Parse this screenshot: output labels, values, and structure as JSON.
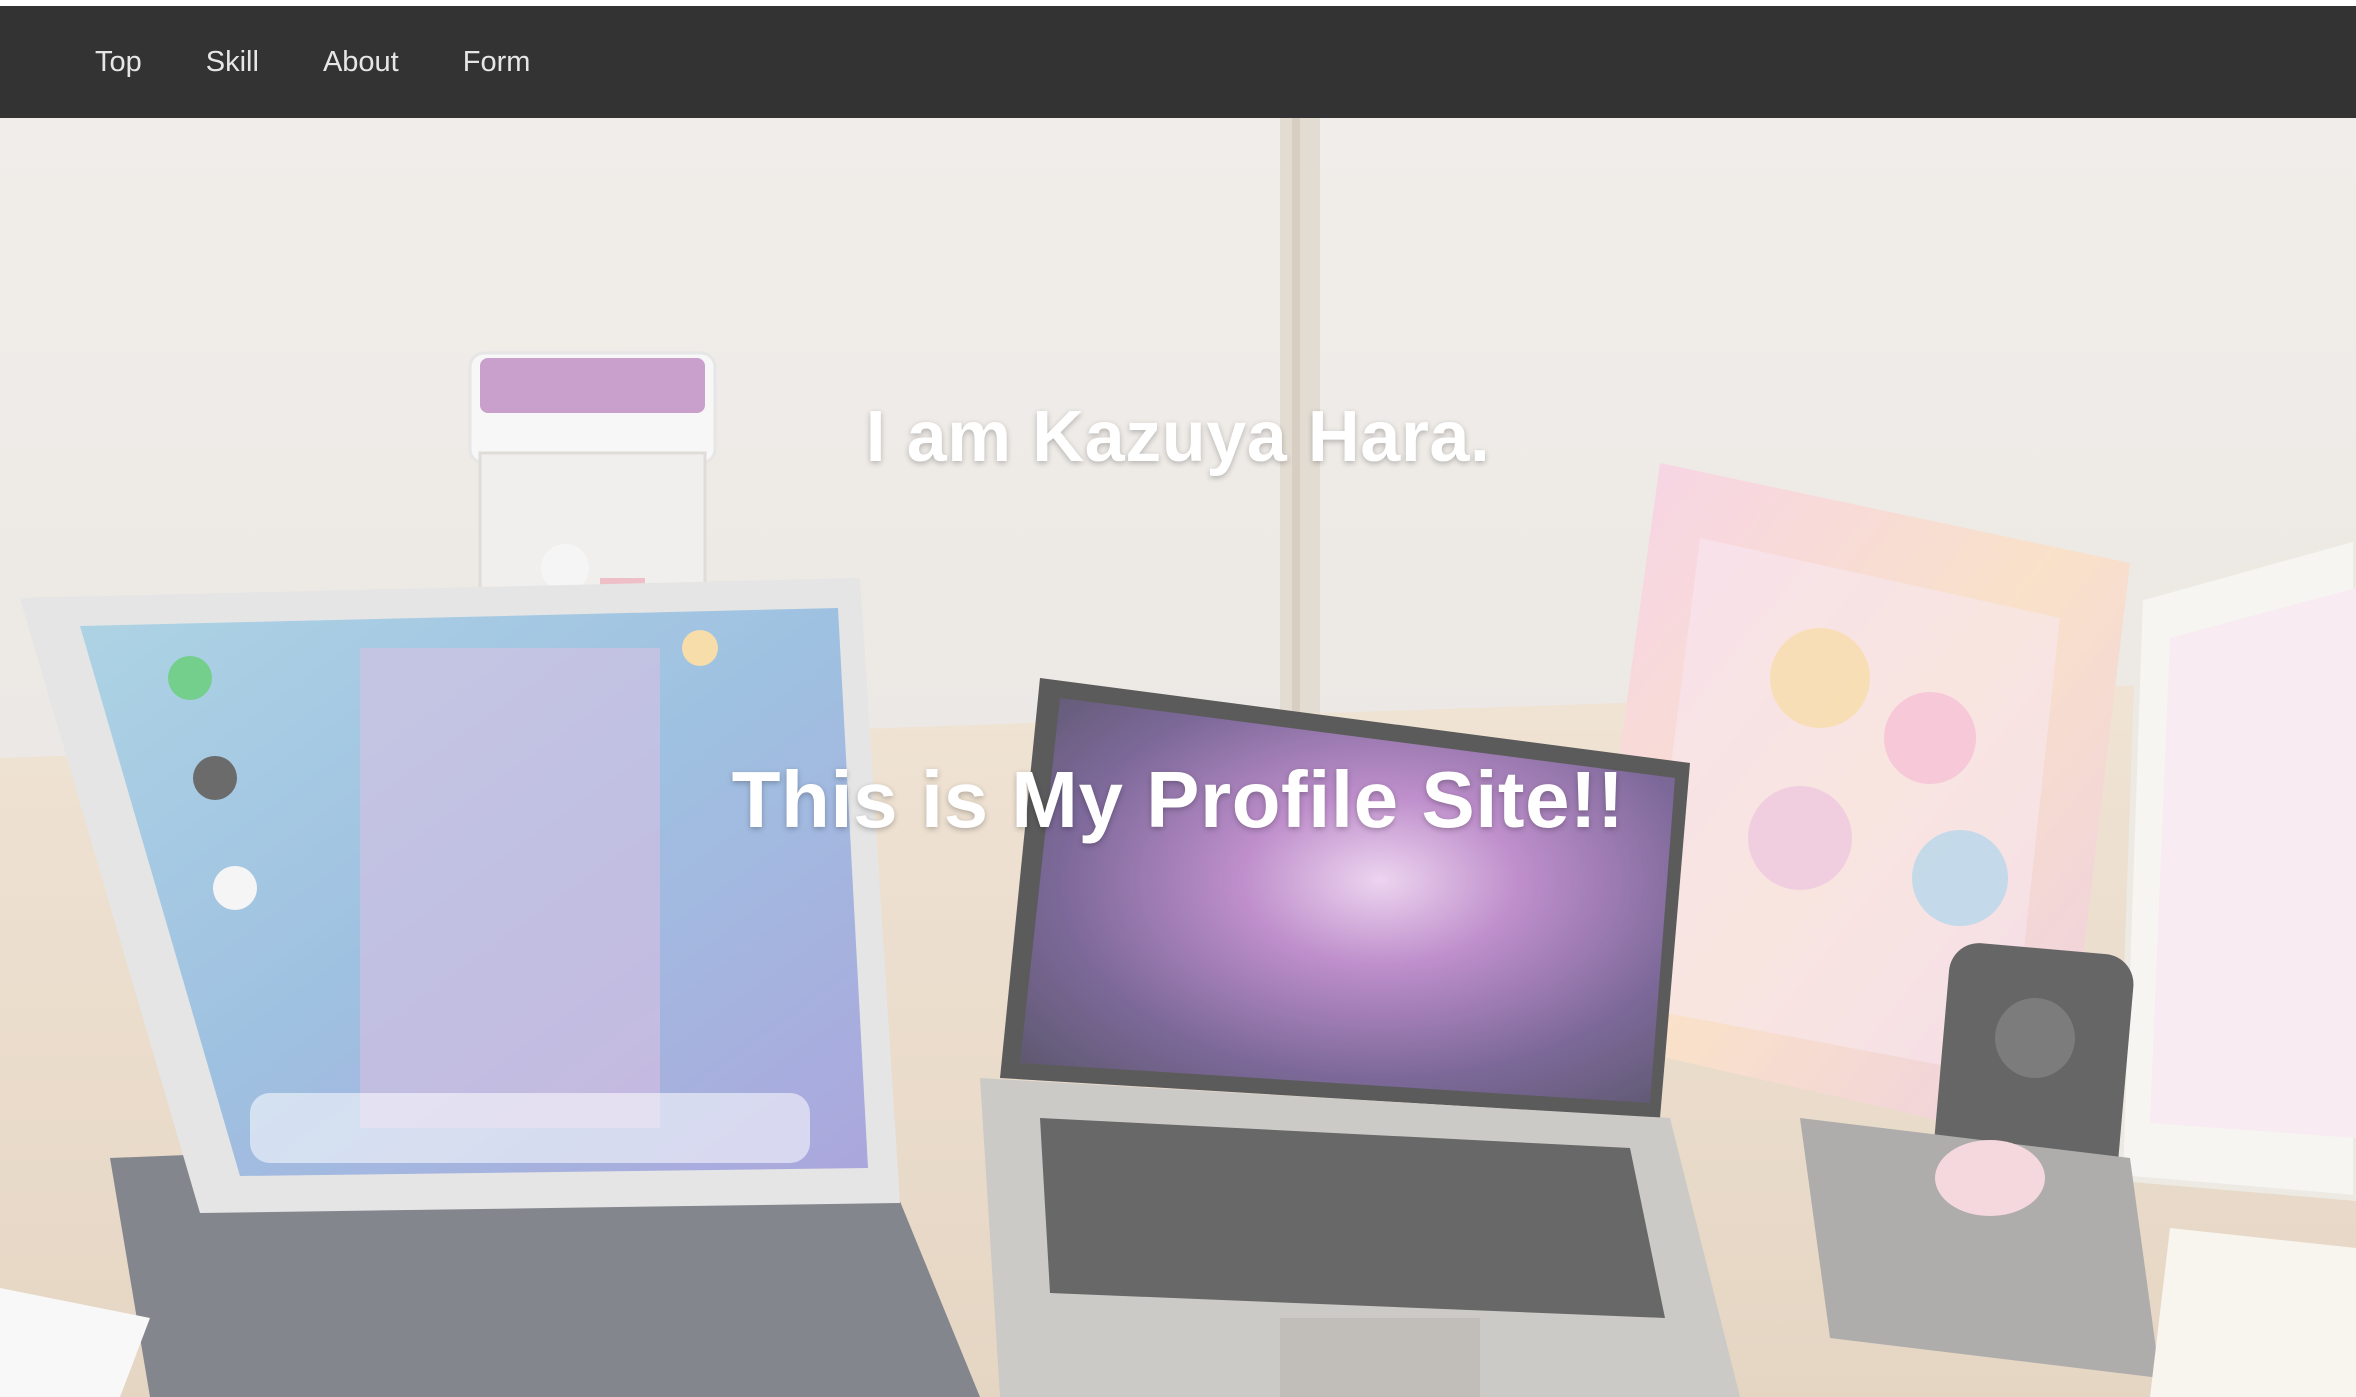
{
  "nav": {
    "items": [
      {
        "label": "Top"
      },
      {
        "label": "Skill"
      },
      {
        "label": "About"
      },
      {
        "label": "Form"
      }
    ]
  },
  "hero": {
    "title": "I am Kazuya Hara.",
    "subtitle": "This is My Profile Site!!"
  },
  "colors": {
    "navbar_bg": "#333333",
    "nav_text": "#e6e6e6",
    "hero_text": "#ffffff"
  }
}
